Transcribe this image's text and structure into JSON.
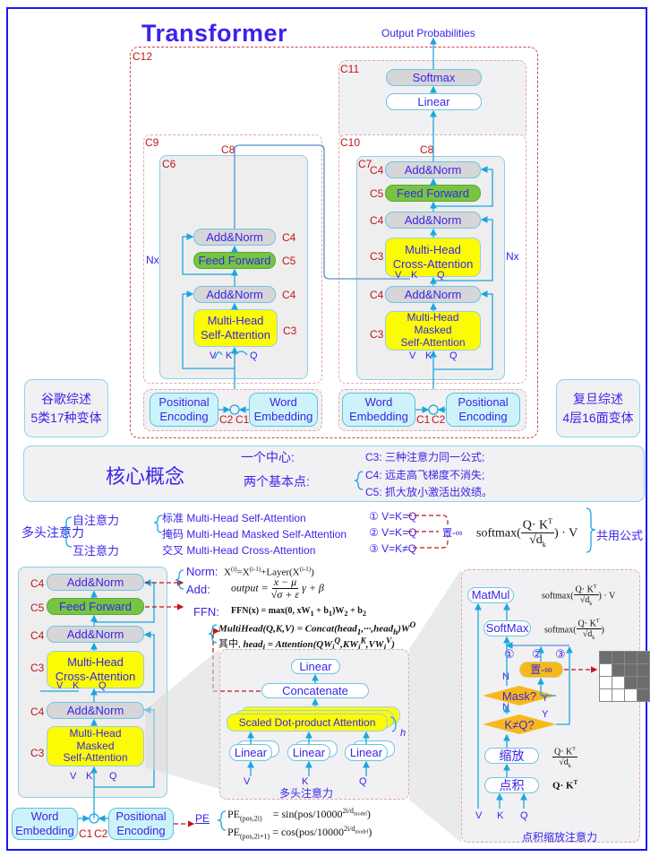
{
  "title": "Transformer",
  "output_label": "Output Probabilities",
  "labels": {
    "c1": "C1",
    "c2": "C2",
    "c3": "C3",
    "c4": "C4",
    "c5": "C5",
    "c6": "C6",
    "c7": "C7",
    "c8": "C8",
    "c9": "C9",
    "c10": "C10",
    "c11": "C11",
    "c12": "C12",
    "nx": "Nx",
    "v": "V",
    "k": "K",
    "q": "Q",
    "h": "h",
    "n": "N",
    "y": "Y",
    "circ1": "①",
    "circ2": "②",
    "circ3": "③"
  },
  "blocks": {
    "softmax": "Softmax",
    "linear": "Linear",
    "add_norm": "Add&Norm",
    "feed_forward": "Feed Forward",
    "mh_self_attn": [
      "Multi-Head",
      "Self-Attention"
    ],
    "mh_cross_attn": [
      "Multi-Head",
      "Cross-Attention"
    ],
    "mh_masked_attn": [
      "Multi-Head",
      "Masked",
      "Self-Attention"
    ],
    "positional_encoding": [
      "Positional",
      "Encoding"
    ],
    "word_embedding": [
      "Word",
      "Embedding"
    ],
    "concatenate": "Concatenate",
    "scaled_dot": "Scaled Dot-product Attention",
    "matmul": "MatMul",
    "softmax2": "SoftMax",
    "set_neg_inf": "置-∞",
    "mask_q": "Mask?",
    "k_ne_q": "K≠Q?",
    "scale": "缩放",
    "dot": "点积"
  },
  "side_panels": {
    "google": [
      "谷歌综述",
      "5类17种变体"
    ],
    "fudan": [
      "复旦综述",
      "4层16面变体"
    ]
  },
  "core": {
    "title": "核心概念",
    "center_label": "一个中心:",
    "points_label": "两个基本点:",
    "c3": "C3: 三种注意力同一公式;",
    "c4": "C4: 远走高飞梯度不消失;",
    "c5": "C5: 抓大放小激活出效绩。"
  },
  "attention_types": {
    "root": "多头注意力",
    "self": "自注意力",
    "cross": "互注意力",
    "standard": "标准 Multi-Head Self-Attention",
    "masked": "掩码 Multi-Head Masked Self-Attention",
    "crossx": "交叉 Multi-Head Cross-Attention",
    "cond1": "① V=K=Q",
    "cond2": "② V=K=Q",
    "cond3": "③ V=K≠Q",
    "set_inf": "置-∞",
    "shared": "共用公式"
  },
  "formulas": {
    "norm_label": "Norm:",
    "norm_eq": "X(i)=X(i-1)+Layer(X(i-1))",
    "add_label": "Add:",
    "add_eq": "output = (x − μ)/(√σ + ε) γ + β",
    "ffn_label": "FFN:",
    "ffn_eq": "FFN(x) = max(0, xW1 + b1)W2 + b2",
    "mh_eq": "MultiHead(Q,K,V) = Concat(head1,···,headh)W^O",
    "head_eq": "其中, headi = Attention(QWiQ, KWiK, VWiV)",
    "pe_label": "PE",
    "pe_sin": "PE(pos,2i)   = sin(pos/10000^(2i/dmodel))",
    "pe_cos": "PE(pos,2i+1) = cos(pos/10000^(2i/dmodel))",
    "softmax_full": "softmax(Q·Kᵀ/√dk)·V",
    "softmax_part": "softmax(Q·Kᵀ/√dk)",
    "scaled": "Q·Kᵀ/√dk",
    "qk": "Q·Kᵀ"
  },
  "captions": {
    "multihead": "多头注意力",
    "scaled_dot": "点积缩放注意力"
  },
  "colors": {
    "accent_blue": "#3a24e8",
    "label_red": "#c0141c",
    "arrow_blue": "#1aa6e0",
    "ffn_green": "#76c442",
    "attn_yellow": "#fbfb04",
    "decision_orange": "#f7b81a"
  }
}
